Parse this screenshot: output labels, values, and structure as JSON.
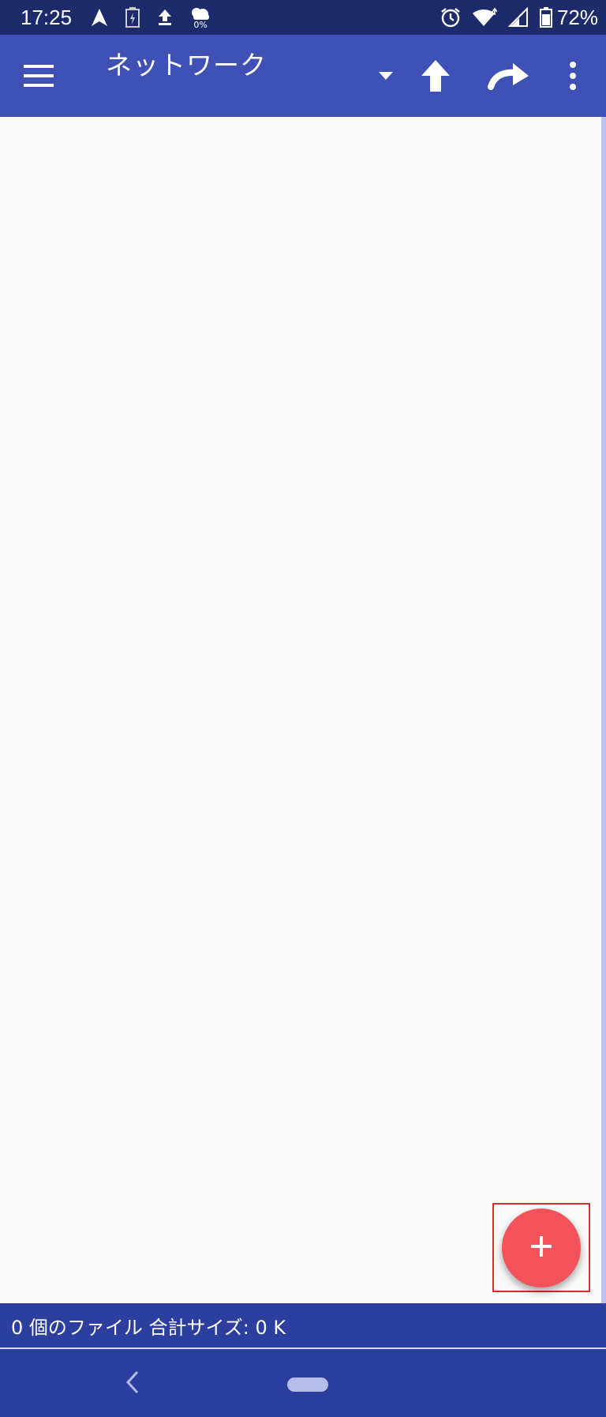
{
  "status_bar": {
    "time": "17:25",
    "data_pct": "0%",
    "battery_pct": "72%"
  },
  "toolbar": {
    "title": "ネットワーク"
  },
  "footer": {
    "summary": "0 個のファイル 合計サイズ: 0 K"
  },
  "colors": {
    "toolbar": "#3f51b5",
    "status_bar": "#1d2b6b",
    "footer": "#2c3e9e",
    "fab": "#f4525a"
  },
  "icons": [
    "menu-icon",
    "dropdown-arrow-icon",
    "arrow-up-icon",
    "redo-icon",
    "more-vert-icon",
    "plus-icon",
    "back-icon",
    "home-pill-icon"
  ]
}
